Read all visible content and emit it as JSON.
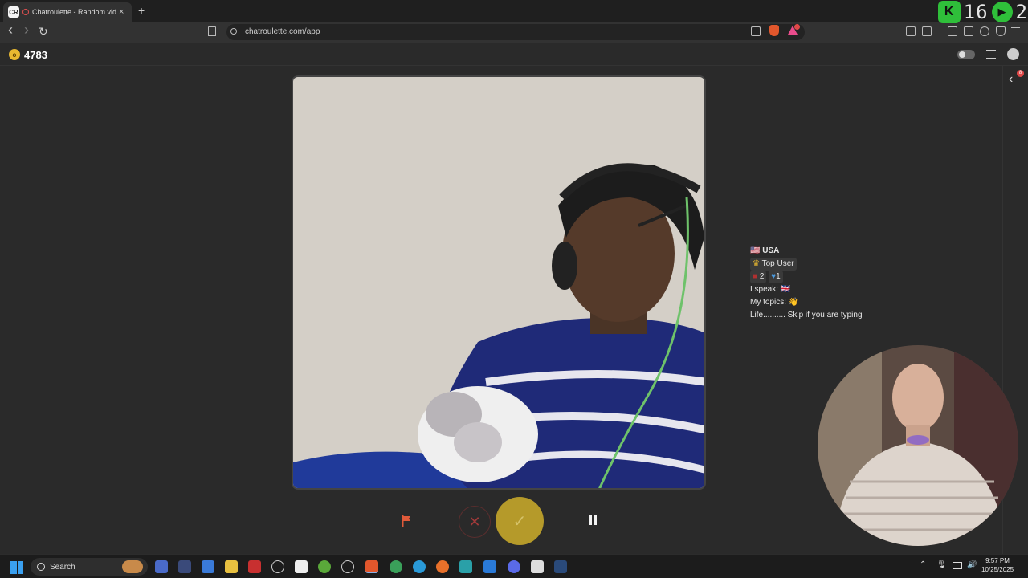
{
  "browser": {
    "tab_title": "Chatroulette - Random video",
    "tab_favicon_text": "CR",
    "tab_close": "×",
    "new_tab": "+",
    "url": "chatroulette.com/app",
    "nav_back": "‹",
    "nav_forward": "›",
    "nav_reload": "↻"
  },
  "overlay": {
    "k_label": "K",
    "count_a": "16",
    "count_b": "2"
  },
  "app": {
    "coins": "4783",
    "coin_symbol": "o",
    "rail_badge": "8",
    "rail_arrow": "‹"
  },
  "partner": {
    "country": "USA",
    "status": "Top User",
    "stats_a": "2",
    "stats_b": "1",
    "speak_label": "I speak:",
    "topics_label": "My topics:",
    "topics_emoji": "👋",
    "bio": "Life..........  Skip if you are typing"
  },
  "controls": {
    "skip_symbol": "✕",
    "accept_symbol": "✓"
  },
  "taskbar": {
    "search_placeholder": "Search",
    "time": "9:57 PM",
    "date": "10/25/2025"
  },
  "colors": {
    "accent_yellow": "#b59a2a",
    "overlay_green": "#2fbf3a",
    "coin_gold": "#e8b830",
    "flag_red": "#e05a3a"
  }
}
